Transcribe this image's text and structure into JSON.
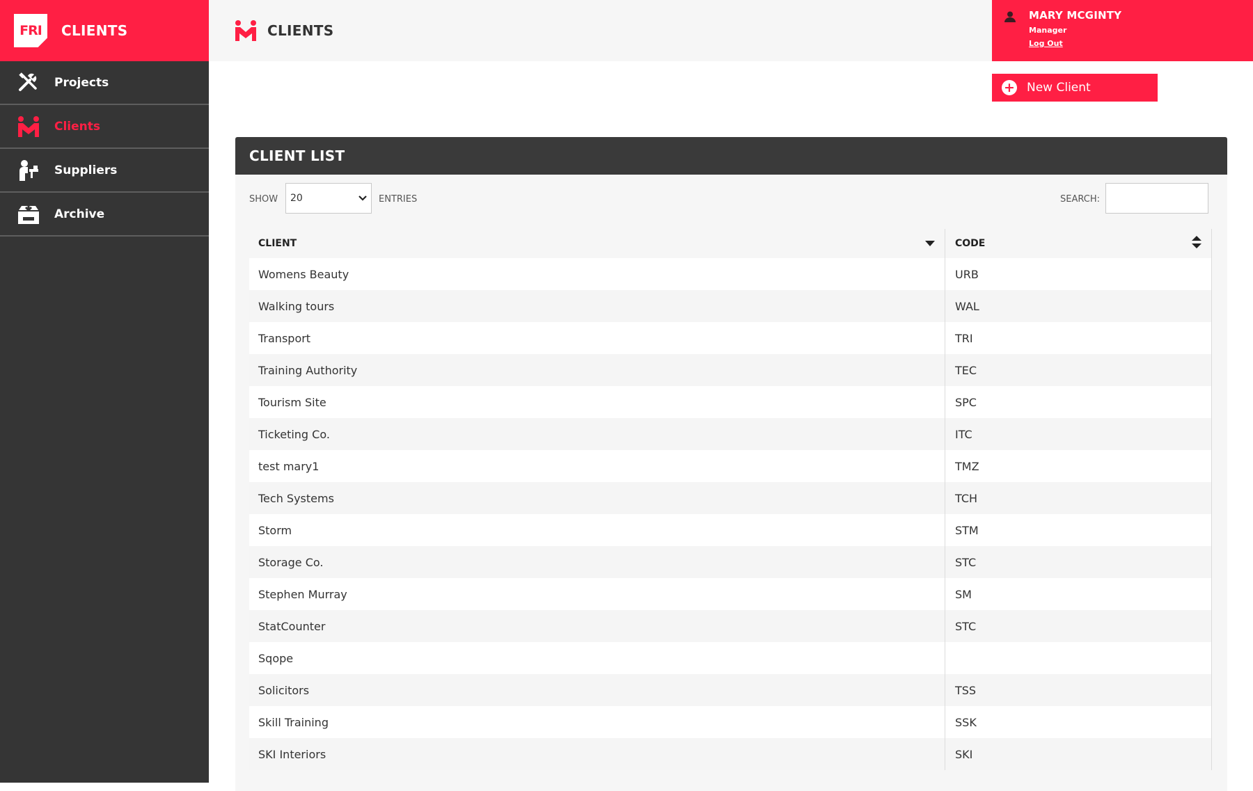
{
  "brand": {
    "logo_text": "FRI",
    "title": "CLIENTS"
  },
  "sidebar": {
    "items": [
      {
        "label": "Projects",
        "icon": "tools-icon",
        "active": false
      },
      {
        "label": "Clients",
        "icon": "clients-icon",
        "active": true
      },
      {
        "label": "Suppliers",
        "icon": "supplier-icon",
        "active": false
      },
      {
        "label": "Archive",
        "icon": "archive-icon",
        "active": false
      }
    ]
  },
  "header": {
    "title": "CLIENTS",
    "icon": "clients-icon"
  },
  "user": {
    "name": "MARY MCGINTY",
    "role": "Manager",
    "logout_label": "Log Out",
    "icon": "user-icon"
  },
  "actions": {
    "new_client_label": "New Client",
    "icon": "plus-circle-icon"
  },
  "colors": {
    "accent": "#ff1f44",
    "sidebar_bg": "#353535",
    "panel_header_bg": "#3a3a3a"
  },
  "panel": {
    "title": "CLIENT LIST",
    "show_label": "SHOW",
    "entries_value": "20",
    "entries_label": "ENTRIES",
    "search_label": "SEARCH:",
    "search_value": ""
  },
  "table": {
    "columns": [
      "CLIENT",
      "CODE"
    ],
    "rows": [
      {
        "client": "Womens Beauty",
        "code": "URB"
      },
      {
        "client": "Walking tours",
        "code": "WAL"
      },
      {
        "client": "Transport",
        "code": "TRI"
      },
      {
        "client": "Training Authority",
        "code": "TEC"
      },
      {
        "client": "Tourism Site",
        "code": "SPC"
      },
      {
        "client": "Ticketing Co.",
        "code": "ITC"
      },
      {
        "client": "test mary1",
        "code": "TMZ"
      },
      {
        "client": "Tech Systems",
        "code": "TCH"
      },
      {
        "client": "Storm",
        "code": "STM"
      },
      {
        "client": "Storage Co.",
        "code": "STC"
      },
      {
        "client": "Stephen Murray",
        "code": "SM"
      },
      {
        "client": "StatCounter",
        "code": "STC"
      },
      {
        "client": "Sqope",
        "code": ""
      },
      {
        "client": "Solicitors",
        "code": "TSS"
      },
      {
        "client": "Skill Training",
        "code": "SSK"
      },
      {
        "client": "SKI Interiors",
        "code": "SKI"
      }
    ]
  }
}
